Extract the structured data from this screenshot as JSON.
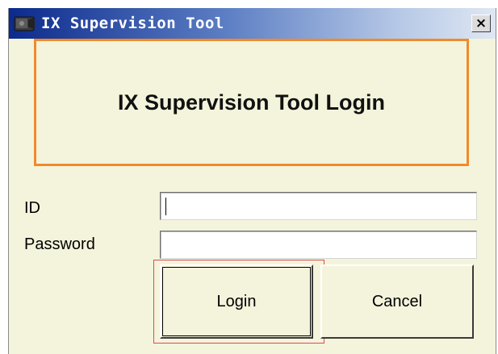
{
  "window": {
    "title": "IX Supervision Tool",
    "close_label": "×",
    "icon": "app-camera-icon"
  },
  "banner": {
    "title": "IX Supervision Tool Login",
    "border_color": "#f08a2b"
  },
  "form": {
    "id_label": "ID",
    "id_value": "",
    "password_label": "Password",
    "password_value": ""
  },
  "buttons": {
    "login_label": "Login",
    "cancel_label": "Cancel"
  },
  "colors": {
    "background": "#f4f4dc",
    "titlebar_start": "#0c2a8c",
    "titlebar_end": "#dfe7f3",
    "focus_highlight": "#e04a4a"
  }
}
